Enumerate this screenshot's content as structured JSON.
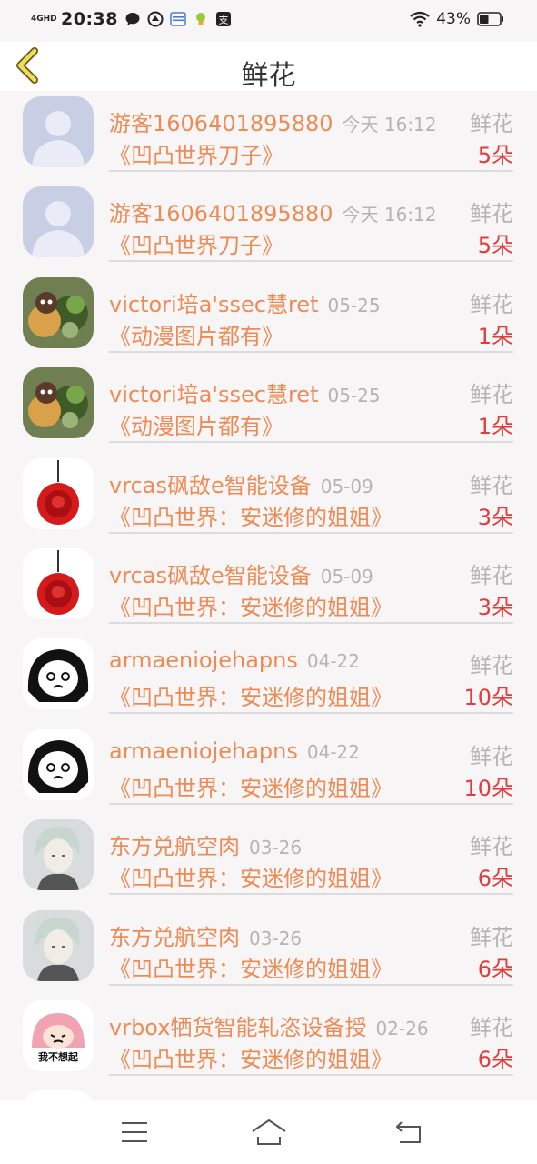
{
  "status_bar": {
    "network": "4GHD",
    "time": "20:38",
    "battery": "43%"
  },
  "header": {
    "title": "鲜花"
  },
  "records": [
    {
      "user": "游客1606401895880",
      "time": "今天 16:12",
      "label": "鲜花",
      "work": "《凹凸世界刀子》",
      "count": "5朵",
      "avatar": "default"
    },
    {
      "user": "游客1606401895880",
      "time": "今天 16:12",
      "label": "鲜花",
      "work": "《凹凸世界刀子》",
      "count": "5朵",
      "avatar": "default"
    },
    {
      "user": "victori培a'ssec慧ret",
      "time": "05-25",
      "label": "鲜花",
      "work": "《动漫图片都有》",
      "count": "1朵",
      "avatar": "food"
    },
    {
      "user": "victori培a'ssec慧ret",
      "time": "05-25",
      "label": "鲜花",
      "work": "《动漫图片都有》",
      "count": "1朵",
      "avatar": "food"
    },
    {
      "user": "vrcas砜敌e智能设备",
      "time": "05-09",
      "label": "鲜花",
      "work": "《凹凸世界：安迷修的姐姐》",
      "count": "3朵",
      "avatar": "rose"
    },
    {
      "user": "vrcas砜敌e智能设备",
      "time": "05-09",
      "label": "鲜花",
      "work": "《凹凸世界：安迷修的姐姐》",
      "count": "3朵",
      "avatar": "rose"
    },
    {
      "user": "armaeniojehapns",
      "time": "04-22",
      "label": "鲜花",
      "work": "《凹凸世界：安迷修的姐姐》",
      "count": "10朵",
      "avatar": "cartoon"
    },
    {
      "user": "armaeniojehapns",
      "time": "04-22",
      "label": "鲜花",
      "work": "《凹凸世界：安迷修的姐姐》",
      "count": "10朵",
      "avatar": "cartoon"
    },
    {
      "user": "东方兑航空肉",
      "time": "03-26",
      "label": "鲜花",
      "work": "《凹凸世界：安迷修的姐姐》",
      "count": "6朵",
      "avatar": "anime"
    },
    {
      "user": "东方兑航空肉",
      "time": "03-26",
      "label": "鲜花",
      "work": "《凹凸世界：安迷修的姐姐》",
      "count": "6朵",
      "avatar": "anime"
    },
    {
      "user": "vrbox牺货智能轧恣设备授",
      "time": "02-26",
      "label": "鲜花",
      "work": "《凹凸世界：安迷修的姐姐》",
      "count": "6朵",
      "avatar": "sticker",
      "avatar_text": "我不想起"
    }
  ],
  "colors": {
    "accent": "#ee8b55",
    "count": "#e33a3a",
    "muted": "#b4b4b4",
    "back_icon": "#e8d44d"
  }
}
